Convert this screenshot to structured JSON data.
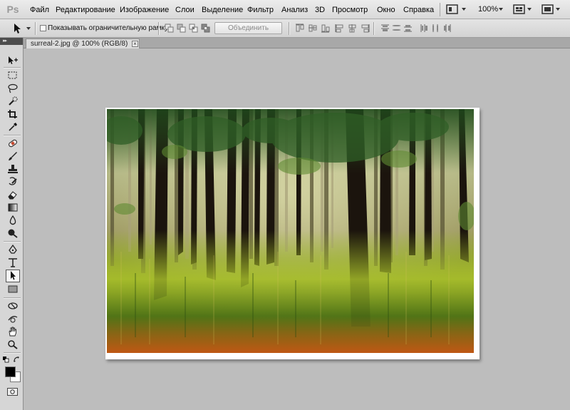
{
  "app": {
    "logo": "Ps"
  },
  "menu": [
    "Файл",
    "Редактирование",
    "Изображение",
    "Слои",
    "Выделение",
    "Фильтр",
    "Анализ",
    "3D",
    "Просмотр",
    "Окно",
    "Справка"
  ],
  "menubar_right": {
    "zoom": "100%"
  },
  "options": {
    "checkbox_label": "Показывать ограничительную рамку",
    "checkbox_checked": false,
    "combine_button": "Объединить"
  },
  "document": {
    "tab_title": "surreal-2.jpg @ 100% (RGB/8)",
    "close_glyph": "×"
  },
  "tools": [
    "move-tool",
    "marquee-tool",
    "lasso-tool",
    "quick-selection-tool",
    "crop-tool",
    "eyedropper-tool",
    "spot-healing-tool",
    "brush-tool",
    "clone-stamp-tool",
    "history-brush-tool",
    "eraser-tool",
    "gradient-tool",
    "blur-tool",
    "dodge-tool",
    "pen-tool",
    "type-tool",
    "path-selection-tool",
    "rectangle-tool",
    "3d-rotate-tool",
    "3d-orbit-tool",
    "hand-tool",
    "zoom-tool"
  ],
  "active_tool": "path-selection-tool",
  "colors": {
    "foreground": "#000000",
    "background": "#ffffff"
  }
}
